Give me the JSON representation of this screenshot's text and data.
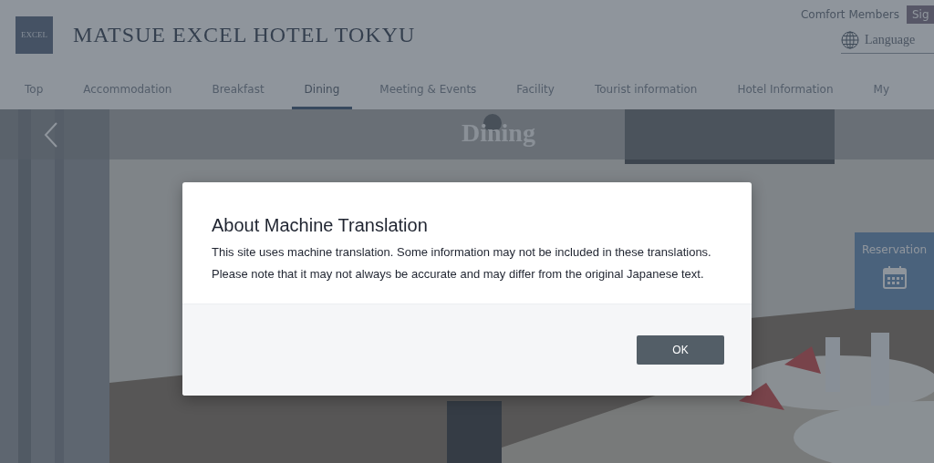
{
  "header": {
    "logo": "EXCEL",
    "title": "MATSUE EXCEL HOTEL TOKYU",
    "members": "Comfort Members",
    "sign_button": "Sig",
    "language": "Language"
  },
  "nav": [
    {
      "label": "Top",
      "selected": false
    },
    {
      "label": "Accommodation",
      "selected": false
    },
    {
      "label": "Breakfast",
      "selected": false
    },
    {
      "label": "Dining",
      "selected": true
    },
    {
      "label": "Meeting & Events",
      "selected": false
    },
    {
      "label": "Facility",
      "selected": false
    },
    {
      "label": "Tourist information",
      "selected": false
    },
    {
      "label": "Hotel Information",
      "selected": false
    },
    {
      "label": "My",
      "selected": false
    }
  ],
  "hero": {
    "title": "Dining",
    "reservation": "Reservation"
  },
  "dialog": {
    "title": "About Machine Translation",
    "body": "This site uses machine translation. Some information may not be included in these translations. Please note that it may not always be accurate and may differ from the original Japanese text.",
    "button": "OK"
  }
}
